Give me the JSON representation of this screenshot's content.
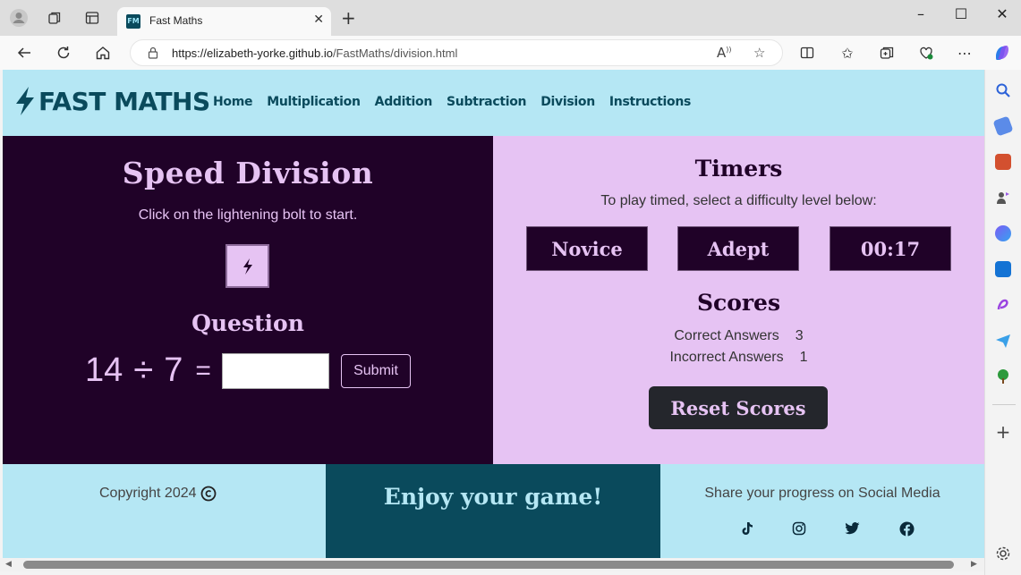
{
  "browser": {
    "tab_title": "Fast Maths",
    "tab_favicon_text": "FM",
    "url_host": "https://elizabeth-yorke.github.io",
    "url_path": "/FastMaths/division.html"
  },
  "site": {
    "logo_text": "FAST MATHS",
    "nav": [
      "Home",
      "Multiplication",
      "Addition",
      "Subtraction",
      "Division",
      "Instructions"
    ]
  },
  "game": {
    "title": "Speed Division",
    "subtitle": "Click on the lightening bolt to start.",
    "question_title": "Question",
    "operand1": "14",
    "operator": "÷",
    "operand2": "7",
    "equals": "=",
    "answer_value": "",
    "submit_label": "Submit"
  },
  "timers": {
    "title": "Timers",
    "subtitle": "To play timed, select a difficulty level below:",
    "buttons": [
      "Novice",
      "Adept",
      "00:17"
    ]
  },
  "scores": {
    "title": "Scores",
    "correct_label": "Correct Answers",
    "correct_value": "3",
    "incorrect_label": "Incorrect Answers",
    "incorrect_value": "1",
    "reset_label": "Reset Scores"
  },
  "footer": {
    "copyright": "Copyright 2024",
    "enjoy": "Enjoy your game!",
    "share": "Share your progress on Social Media",
    "social_icons": [
      "tiktok-icon",
      "instagram-icon",
      "twitter-icon",
      "facebook-icon"
    ]
  },
  "colors": {
    "header_bg": "#b5e7f4",
    "dark_purple": "#200228",
    "light_purple": "#e6c3f3",
    "teal": "#0a4a5c"
  }
}
